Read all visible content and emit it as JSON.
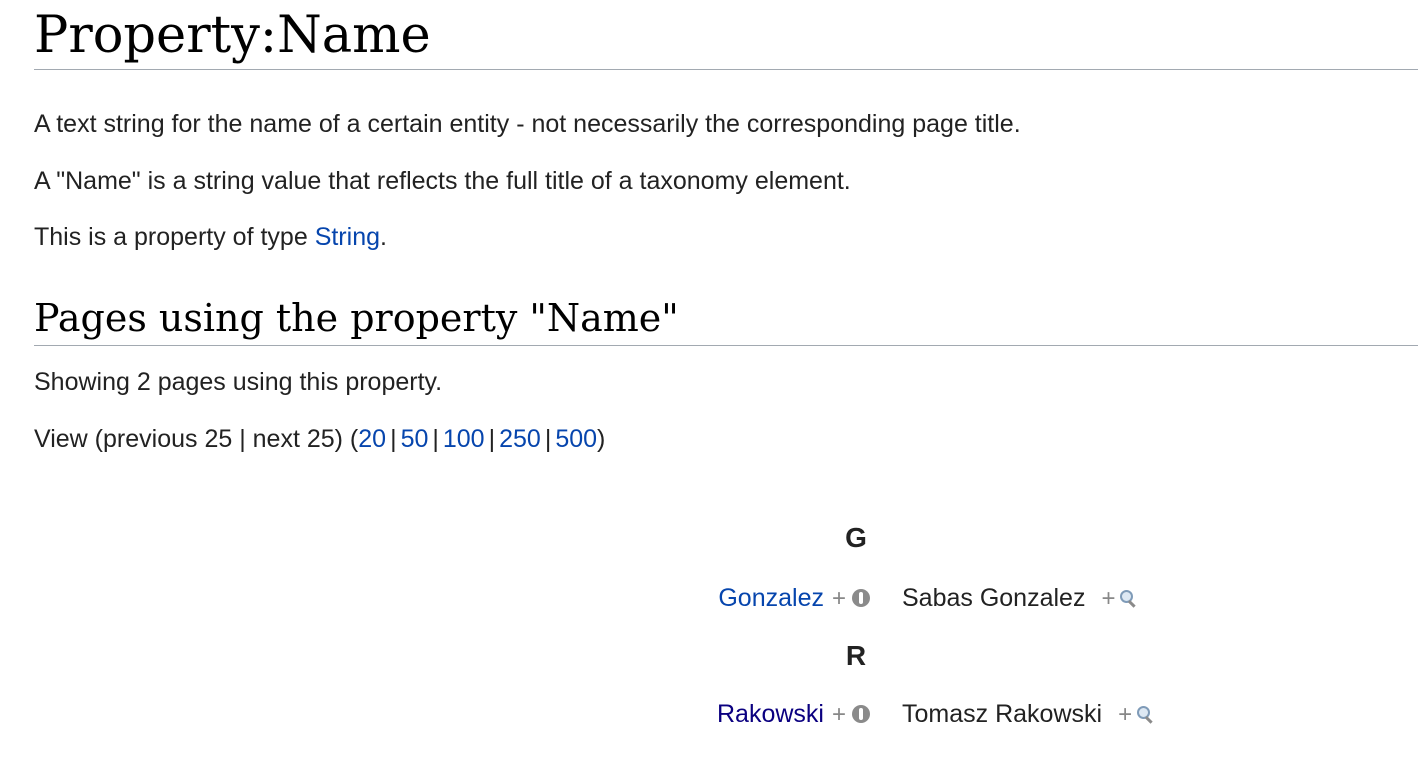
{
  "title": "Property:Name",
  "description": {
    "line1": "A text string for the name of a certain entity - not necessarily the corresponding page title.",
    "line2": "A \"Name\" is a string value that reflects the full title of a taxonomy element.",
    "type_prefix": "This is a property of type ",
    "type_link": "String",
    "type_suffix": "."
  },
  "section": {
    "heading": "Pages using the property \"Name\"",
    "showing": "Showing 2 pages using this property.",
    "view_prefix": "View (previous 25 | next 25) (",
    "limits": [
      "20",
      "50",
      "100",
      "250",
      "500"
    ],
    "separator": "|",
    "view_suffix": ")"
  },
  "groups": [
    {
      "letter": "G",
      "page": "Gonzalez",
      "plus": "+",
      "value": "Sabas Gonzalez",
      "value_plus": "+",
      "visited": false
    },
    {
      "letter": "R",
      "page": "Rakowski",
      "plus": "+",
      "value": "Tomasz Rakowski",
      "value_plus": "+",
      "visited": true
    }
  ],
  "icons": {
    "browse": "browse-icon",
    "search": "search-icon"
  },
  "colors": {
    "link": "#0645ad",
    "visited_link": "#0b0080",
    "rule": "#a2a9b1"
  }
}
